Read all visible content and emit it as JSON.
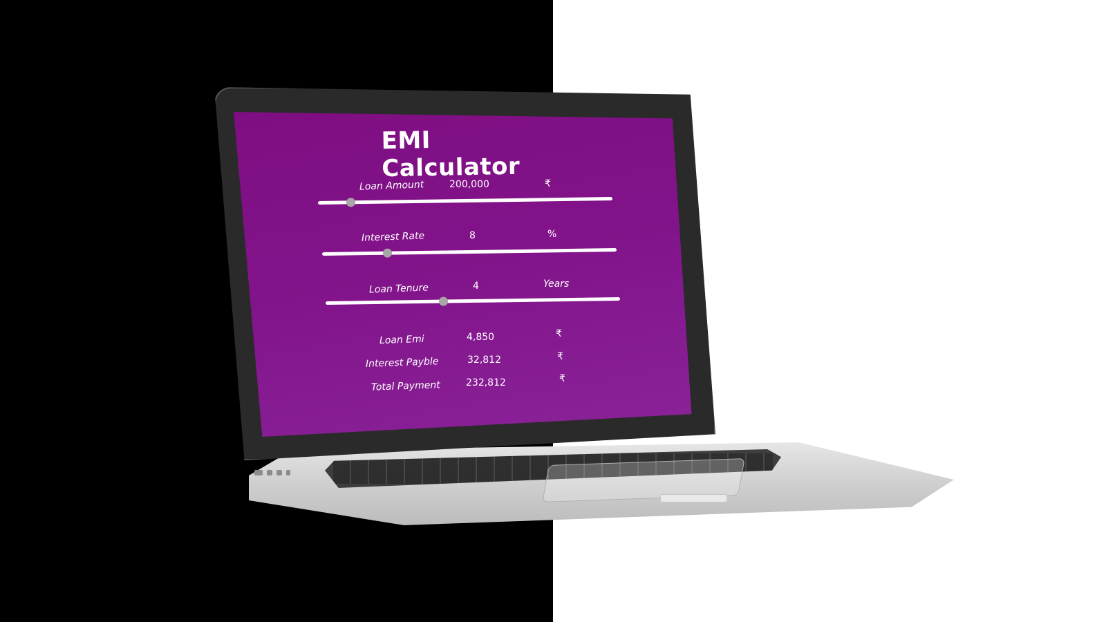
{
  "app": {
    "title": "EMI Calculator"
  },
  "inputs": [
    {
      "label": "Loan Amount",
      "value": "200,000",
      "unit": "₹",
      "level": 0.11
    },
    {
      "label": "Interest Rate",
      "value": "8",
      "unit": "%",
      "level": 0.22
    },
    {
      "label": "Loan Tenure",
      "value": "4",
      "unit": "Years",
      "level": 0.4
    }
  ],
  "results": [
    {
      "label": "Loan Emi",
      "value": "4,850",
      "unit": "₹"
    },
    {
      "label": "Interest Payble",
      "value": "32,812",
      "unit": "₹"
    },
    {
      "label": "Total Payment",
      "value": "232,812",
      "unit": "₹"
    }
  ],
  "colors": {
    "screen_purple": "#80107f",
    "text": "#ffffff",
    "slider_track": "#ffffff",
    "slider_thumb": "#a7a7a7",
    "background_left": "#000000",
    "background_right": "#ffffff"
  }
}
